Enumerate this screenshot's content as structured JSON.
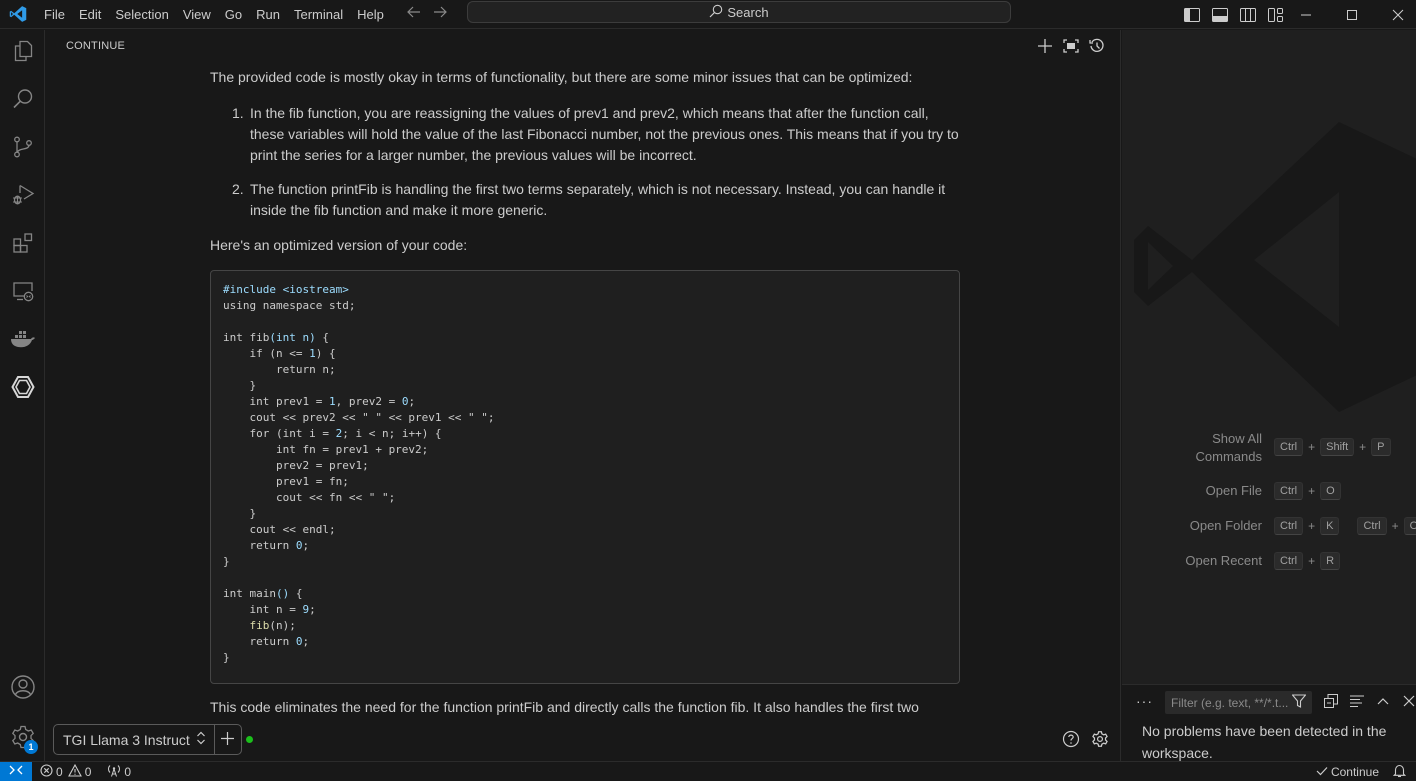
{
  "titlebar": {
    "app_icon": "vscode-logo-icon",
    "menu": [
      "File",
      "Edit",
      "Selection",
      "View",
      "Go",
      "Run",
      "Terminal",
      "Help"
    ],
    "back_icon": "arrow-left-icon",
    "forward_icon": "arrow-right-icon",
    "search_placeholder": "Search",
    "layout_icons": [
      "toggle-primary-sidebar-icon",
      "toggle-panel-icon",
      "toggle-secondary-sidebar-icon",
      "customize-layout-icon"
    ],
    "window_controls": [
      "minimize-icon",
      "maximize-icon",
      "close-icon"
    ]
  },
  "activitybar": {
    "items": [
      {
        "name": "explorer",
        "icon": "files-icon"
      },
      {
        "name": "search",
        "icon": "search-icon"
      },
      {
        "name": "source-control",
        "icon": "source-control-icon"
      },
      {
        "name": "run-and-debug",
        "icon": "run-debug-icon"
      },
      {
        "name": "extensions",
        "icon": "extensions-icon"
      },
      {
        "name": "remote-explorer",
        "icon": "remote-explorer-icon"
      },
      {
        "name": "docker",
        "icon": "docker-icon"
      },
      {
        "name": "continue",
        "icon": "continue-icon"
      }
    ],
    "accounts_icon": "account-icon",
    "manage_icon": "gear-icon",
    "manage_badge": "1"
  },
  "panel": {
    "title": "CONTINUE",
    "actions": [
      "new-session-icon",
      "fullscreen-icon",
      "history-icon"
    ]
  },
  "chat": {
    "intro": "The provided code is mostly okay in terms of functionality, but there are some minor issues that can be optimized:",
    "list": [
      {
        "num": "1.",
        "text": "In the fib function, you are reassigning the values of prev1 and prev2, which means that after the function call, these variables will hold the value of the last Fibonacci number, not the previous ones. This means that if you try to print the series for a larger number, the previous values will be incorrect."
      },
      {
        "num": "2.",
        "text": "The function printFib is handling the first two terms separately, which is not necessary. Instead, you can handle it inside the fib function and make it more generic."
      }
    ],
    "lead_in": "Here's an optimized version of your code:",
    "code_lines": [
      "#include <iostream>",
      "using namespace std;",
      "",
      "int fib(int n) {",
      "    if (n <= 1) {",
      "        return n;",
      "    }",
      "    int prev1 = 1, prev2 = 0;",
      "    cout << prev2 << \" \" << prev1 << \" \";",
      "    for (int i = 2; i < n; i++) {",
      "        int fn = prev1 + prev2;",
      "        prev2 = prev1;",
      "        prev1 = fn;",
      "        cout << fn << \" \";",
      "    }",
      "    cout << endl;",
      "    return 0;",
      "}",
      "",
      "int main() {",
      "    int n = 9;",
      "    fib(n);",
      "    return 0;",
      "}"
    ],
    "outro": "This code eliminates the need for the function printFib and directly calls the function fib. It also handles the first two"
  },
  "input_bar": {
    "model": "TGI Llama 3 Instruct",
    "model_chevron_icon": "chevron-up-down-icon",
    "add_icon": "plus-icon",
    "status": "connected",
    "status_color": "#1bbf1b",
    "help_icon": "help-icon",
    "settings_icon": "gear-icon"
  },
  "welcome": {
    "watermark_icon": "vscode-watermark-icon",
    "shortcuts": [
      {
        "label": "Show All Commands",
        "keys": [
          [
            "Ctrl",
            "Shift",
            "P"
          ]
        ]
      },
      {
        "label": "Open File",
        "keys": [
          [
            "Ctrl",
            "O"
          ]
        ]
      },
      {
        "label": "Open Folder",
        "keys": [
          [
            "Ctrl",
            "K"
          ],
          [
            "Ctrl",
            "O"
          ]
        ]
      },
      {
        "label": "Open Recent",
        "keys": [
          [
            "Ctrl",
            "R"
          ]
        ]
      }
    ]
  },
  "problems": {
    "more_label": "···",
    "filter_placeholder": "Filter (e.g. text, **/*.t...",
    "message": "No problems have been detected in the workspace.",
    "icons": [
      "filter-icon",
      "collapse-all-icon",
      "view-as-tree-icon",
      "maximize-panel-icon",
      "close-panel-icon"
    ]
  },
  "statusbar": {
    "remote_icon": "remote-icon",
    "errors": "0",
    "warnings": "0",
    "ports": "0",
    "continue_label": "Continue",
    "notifications_icon": "bell-icon"
  },
  "colors": {
    "accent": "#0078d4",
    "background": "#181818",
    "editor_background": "#1f1f1f",
    "text": "#cccccc",
    "code_highlight": "#9cdcfe",
    "function_highlight": "#dcdcaa"
  }
}
